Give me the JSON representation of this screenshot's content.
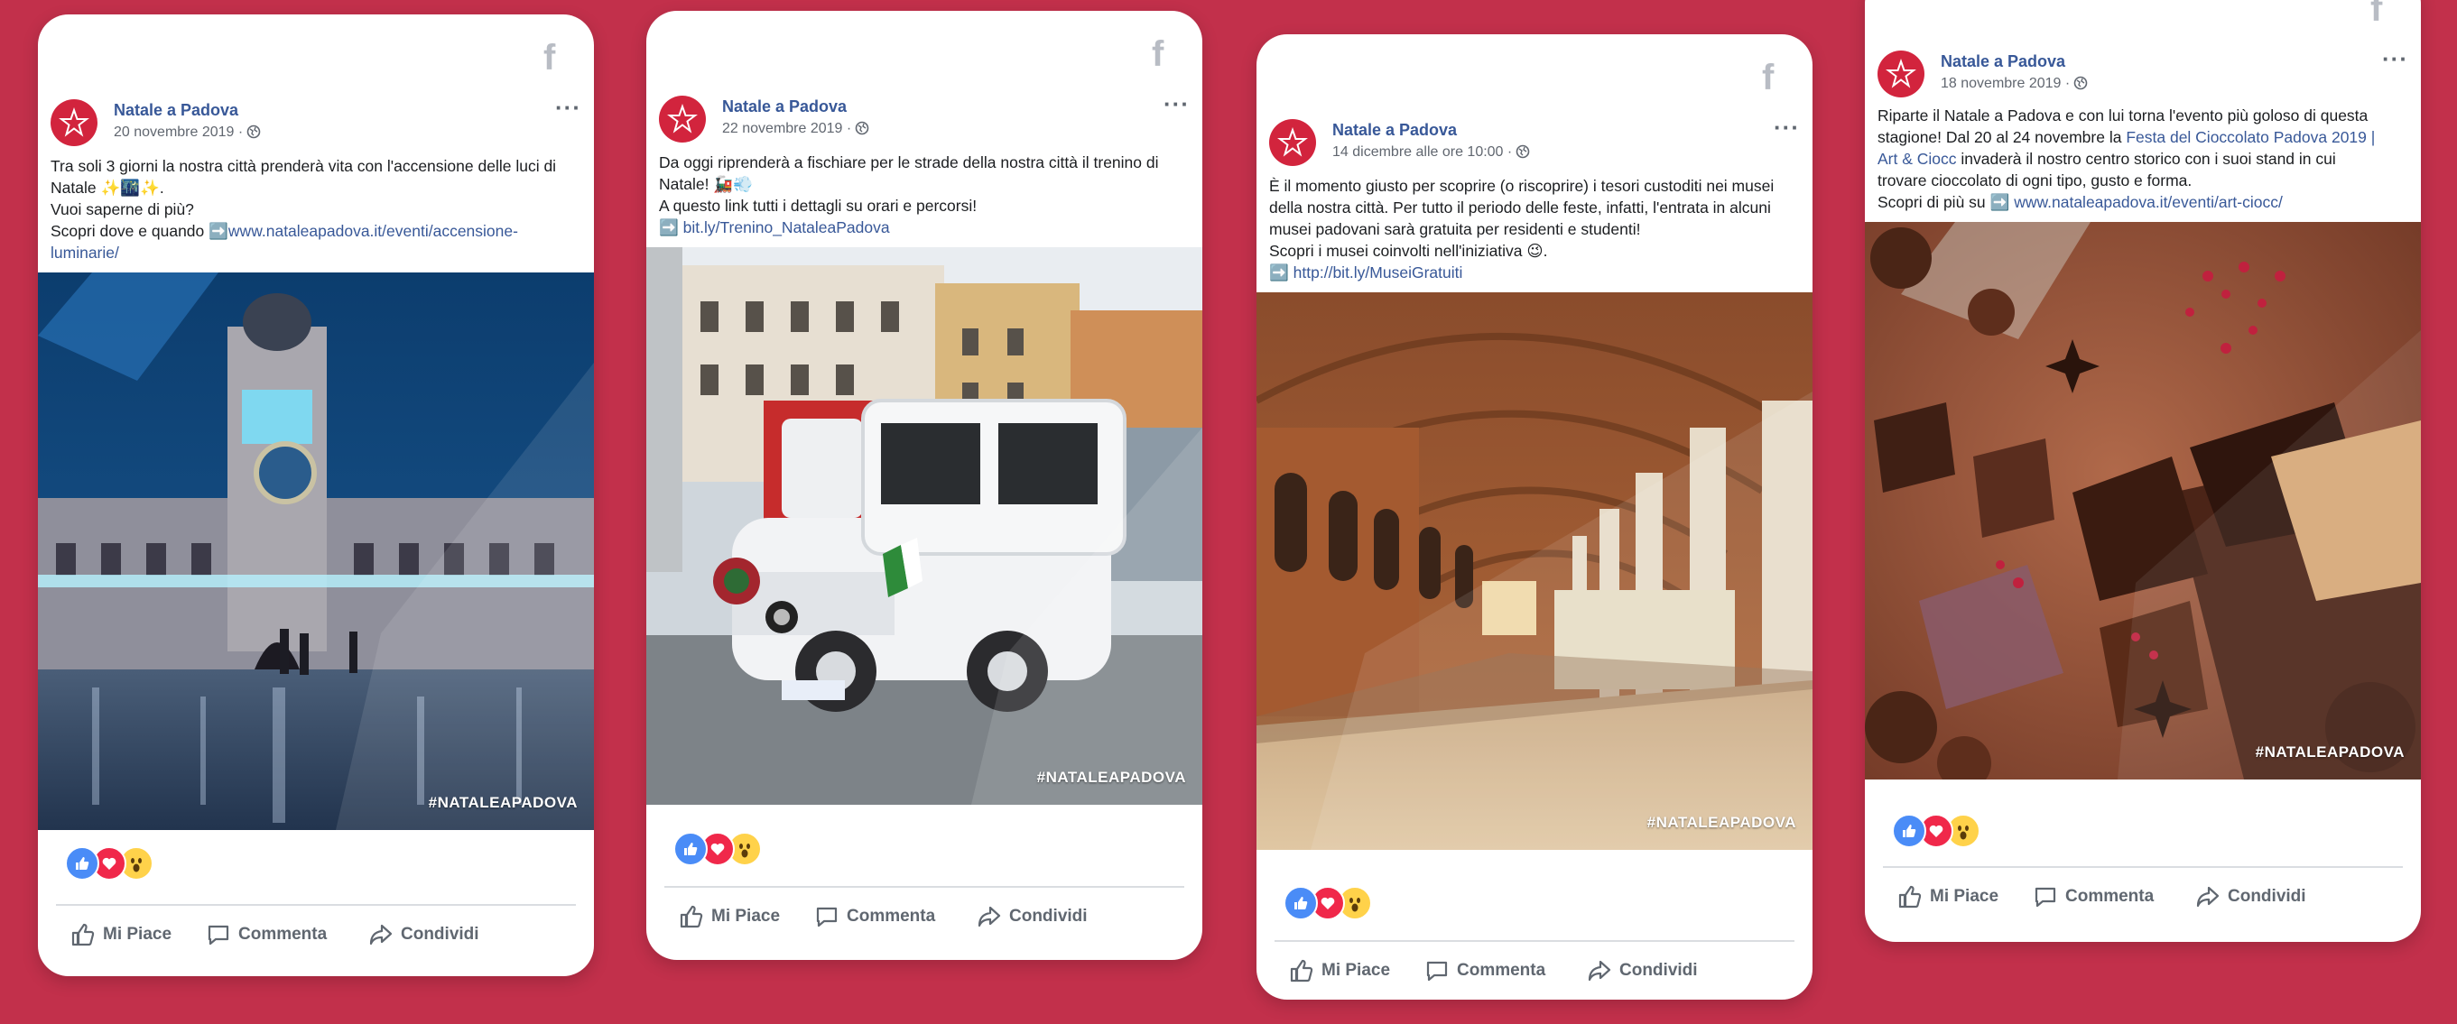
{
  "posts": [
    {
      "page_name": "Natale a Padova",
      "date": "20 novembre 2019 ·",
      "text_lines": [
        "Tra soli 3 giorni la nostra città prenderà vita con l'accensione delle luci di",
        "Natale ✨🌃✨.",
        "Vuoi saperne di più?",
        "Scopri dove e quando ➡️"
      ],
      "link_lines": [
        "www.nataleapadova.it/eventi/accensione-",
        "luminarie/"
      ],
      "hashtag": "#NATALEAPADOVA"
    },
    {
      "page_name": "Natale a Padova",
      "date": "22 novembre 2019 ·",
      "text_lines": [
        "Da oggi riprenderà a fischiare per le strade della nostra città il trenino di",
        "Natale! 🚂💨",
        "A questo link tutti i dettagli su orari e percorsi!",
        "➡️"
      ],
      "link_lines": [
        "bit.ly/Trenino_NataleaPadova"
      ],
      "hashtag": "#NATALEAPADOVA"
    },
    {
      "page_name": "Natale a Padova",
      "date": "14 dicembre alle ore 10:00 ·",
      "text_lines": [
        "È il momento giusto per scoprire (o riscoprire) i tesori custoditi nei musei",
        "della nostra città. Per tutto il periodo delle feste, infatti, l'entrata in alcuni",
        "musei padovani sarà gratuita per residenti e studenti!",
        "Scopri i musei coinvolti nell'iniziativa 😉.",
        "➡️"
      ],
      "link_lines": [
        "http://bit.ly/MuseiGratuiti"
      ],
      "hashtag": "#NATALEAPADOVA"
    },
    {
      "page_name": "Natale a Padova",
      "date": "18 novembre 2019 ·",
      "text_lines": [
        "Riparte il Natale a Padova e con lui torna l'evento più goloso di questa",
        "stagione! Dal 20 al 24 novembre la",
        "invaderà il nostro centro storico con i suoi stand in cui",
        "trovare cioccolato di ogni tipo, gusto e forma.",
        "Scopri di più su ➡️"
      ],
      "event_link_parts": [
        "Festa del Cioccolato Padova 2019 |",
        "Art & Ciocc"
      ],
      "link_lines": [
        "www.nataleapadova.it/eventi/art-ciocc/"
      ],
      "hashtag": "#NATALEAPADOVA"
    }
  ],
  "actions": {
    "like": "Mi Piace",
    "comment": "Commenta",
    "share": "Condividi"
  },
  "colors": {
    "background": "#c2304b",
    "link": "#385898",
    "brand": "#d2243d"
  },
  "icons": [
    "facebook-icon",
    "star-logo-icon",
    "globe-icon",
    "more-options-icon",
    "like-reaction-icon",
    "love-reaction-icon",
    "wow-reaction-icon",
    "thumbs-up-icon",
    "comment-icon",
    "share-icon"
  ]
}
